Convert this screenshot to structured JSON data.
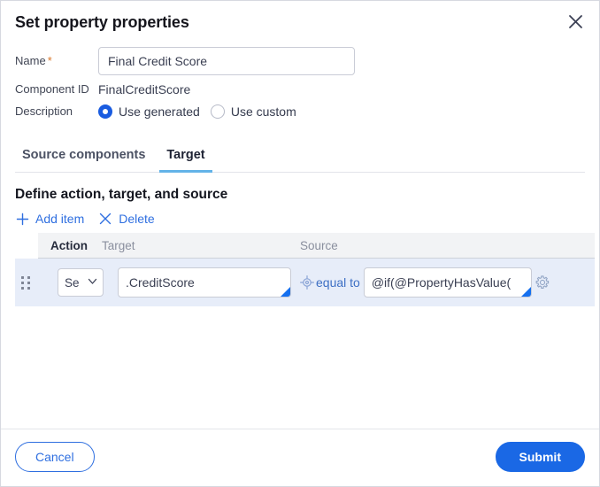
{
  "dialog": {
    "title": "Set property properties",
    "close_icon": "close-icon"
  },
  "form": {
    "name_label": "Name",
    "required_marker": "*",
    "name_value": "Final Credit Score",
    "name_placeholder": "",
    "component_id_label": "Component ID",
    "component_id_value": "FinalCreditScore",
    "description_label": "Description",
    "description_options": [
      {
        "label": "Use generated",
        "selected": true
      },
      {
        "label": "Use custom",
        "selected": false
      }
    ]
  },
  "tabs": [
    {
      "label": "Source components",
      "active": false
    },
    {
      "label": "Target",
      "active": true
    }
  ],
  "section": {
    "heading": "Define action, target, and source",
    "add_item_label": "Add item",
    "add_item_icon": "plus-icon",
    "delete_label": "Delete",
    "delete_icon": "close-x-icon"
  },
  "grid": {
    "columns": [
      "Action",
      "Target",
      "Source"
    ],
    "rows": [
      {
        "drag_handle_icon": "drag-handle-icon",
        "action": "Se",
        "action_chevron_icon": "chevron-down-icon",
        "target": ".CreditScore",
        "crosshair_icon": "crosshair-target-icon",
        "operator": "equal to",
        "source": "@if(@PropertyHasValue(",
        "gear_icon": "gear-icon"
      }
    ]
  },
  "footer": {
    "cancel_label": "Cancel",
    "submit_label": "Submit"
  },
  "colors": {
    "accent_blue": "#1a68e5",
    "link_blue": "#2f6fe0",
    "tab_underline": "#63b3e8",
    "row_highlight": "#e7edf9",
    "header_grey": "#f2f3f5",
    "required_star": "#d9772a"
  }
}
